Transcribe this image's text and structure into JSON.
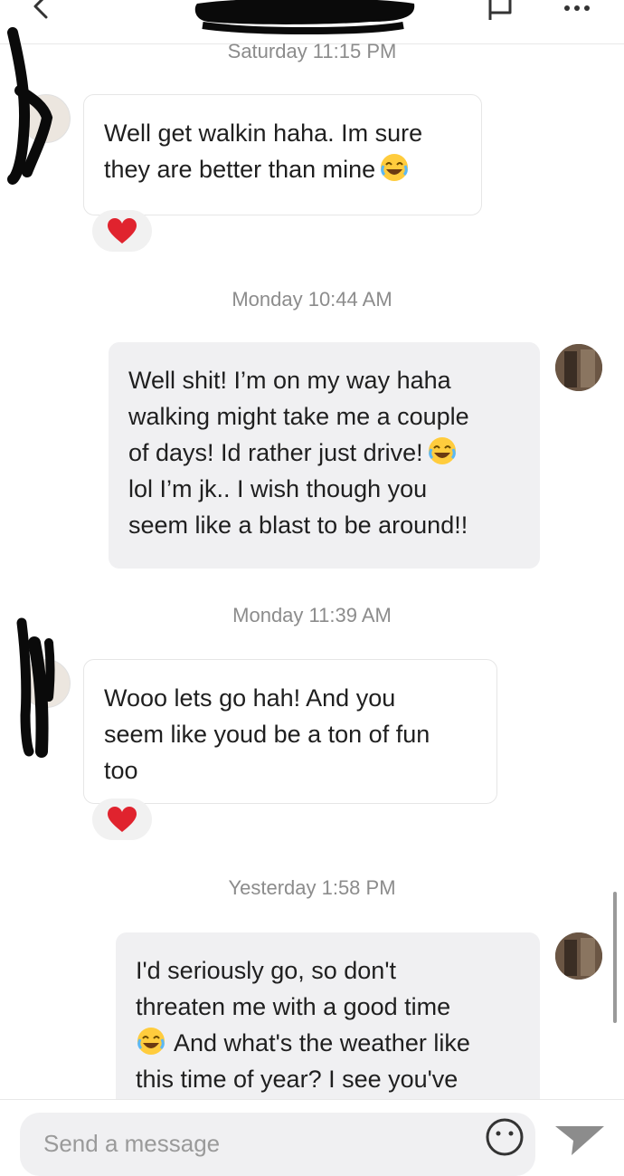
{
  "header": {
    "back_icon": "chevron-left-icon",
    "report_icon": "flag-icon",
    "more_icon": "more-dots-icon"
  },
  "messages": [
    {
      "timestamp": "Saturday 11:15 PM",
      "direction": "incoming",
      "line1": "Well get walkin haha. Im sure",
      "line2": "they are better than mine",
      "emoji": "joy-emoji",
      "reaction": "heart-emoji"
    },
    {
      "timestamp": "Monday 10:44 AM",
      "direction": "outgoing",
      "line1": "Well shit! I’m on my way haha",
      "line2": "walking might take me a couple",
      "line3": "of days! Id rather just drive!",
      "line4": "lol I’m jk.. I wish though you",
      "line5": "seem like a blast to be around!!",
      "emoji": "joy-emoji"
    },
    {
      "timestamp": "Monday 11:39 AM",
      "direction": "incoming",
      "line1": "Wooo lets go hah! And you",
      "line2": "seem like youd be a ton of fun",
      "line3": "too",
      "reaction": "heart-emoji"
    },
    {
      "timestamp": "Yesterday 1:58 PM",
      "direction": "outgoing",
      "line1": "I'd seriously go, so don't",
      "line2": "threaten me with a good time",
      "line3": "And what's the weather like",
      "line4": "this time of year?  I see you've",
      "emoji": "joy-emoji"
    }
  ],
  "composer": {
    "placeholder": "Send a message",
    "emoji_icon": "smiley-icon",
    "send_icon": "send-icon"
  },
  "colors": {
    "outgoing_bubble": "#f0f0f2",
    "incoming_bubble": "#ffffff",
    "timestamp": "#8c8c8c",
    "heart": "#e0232e"
  }
}
